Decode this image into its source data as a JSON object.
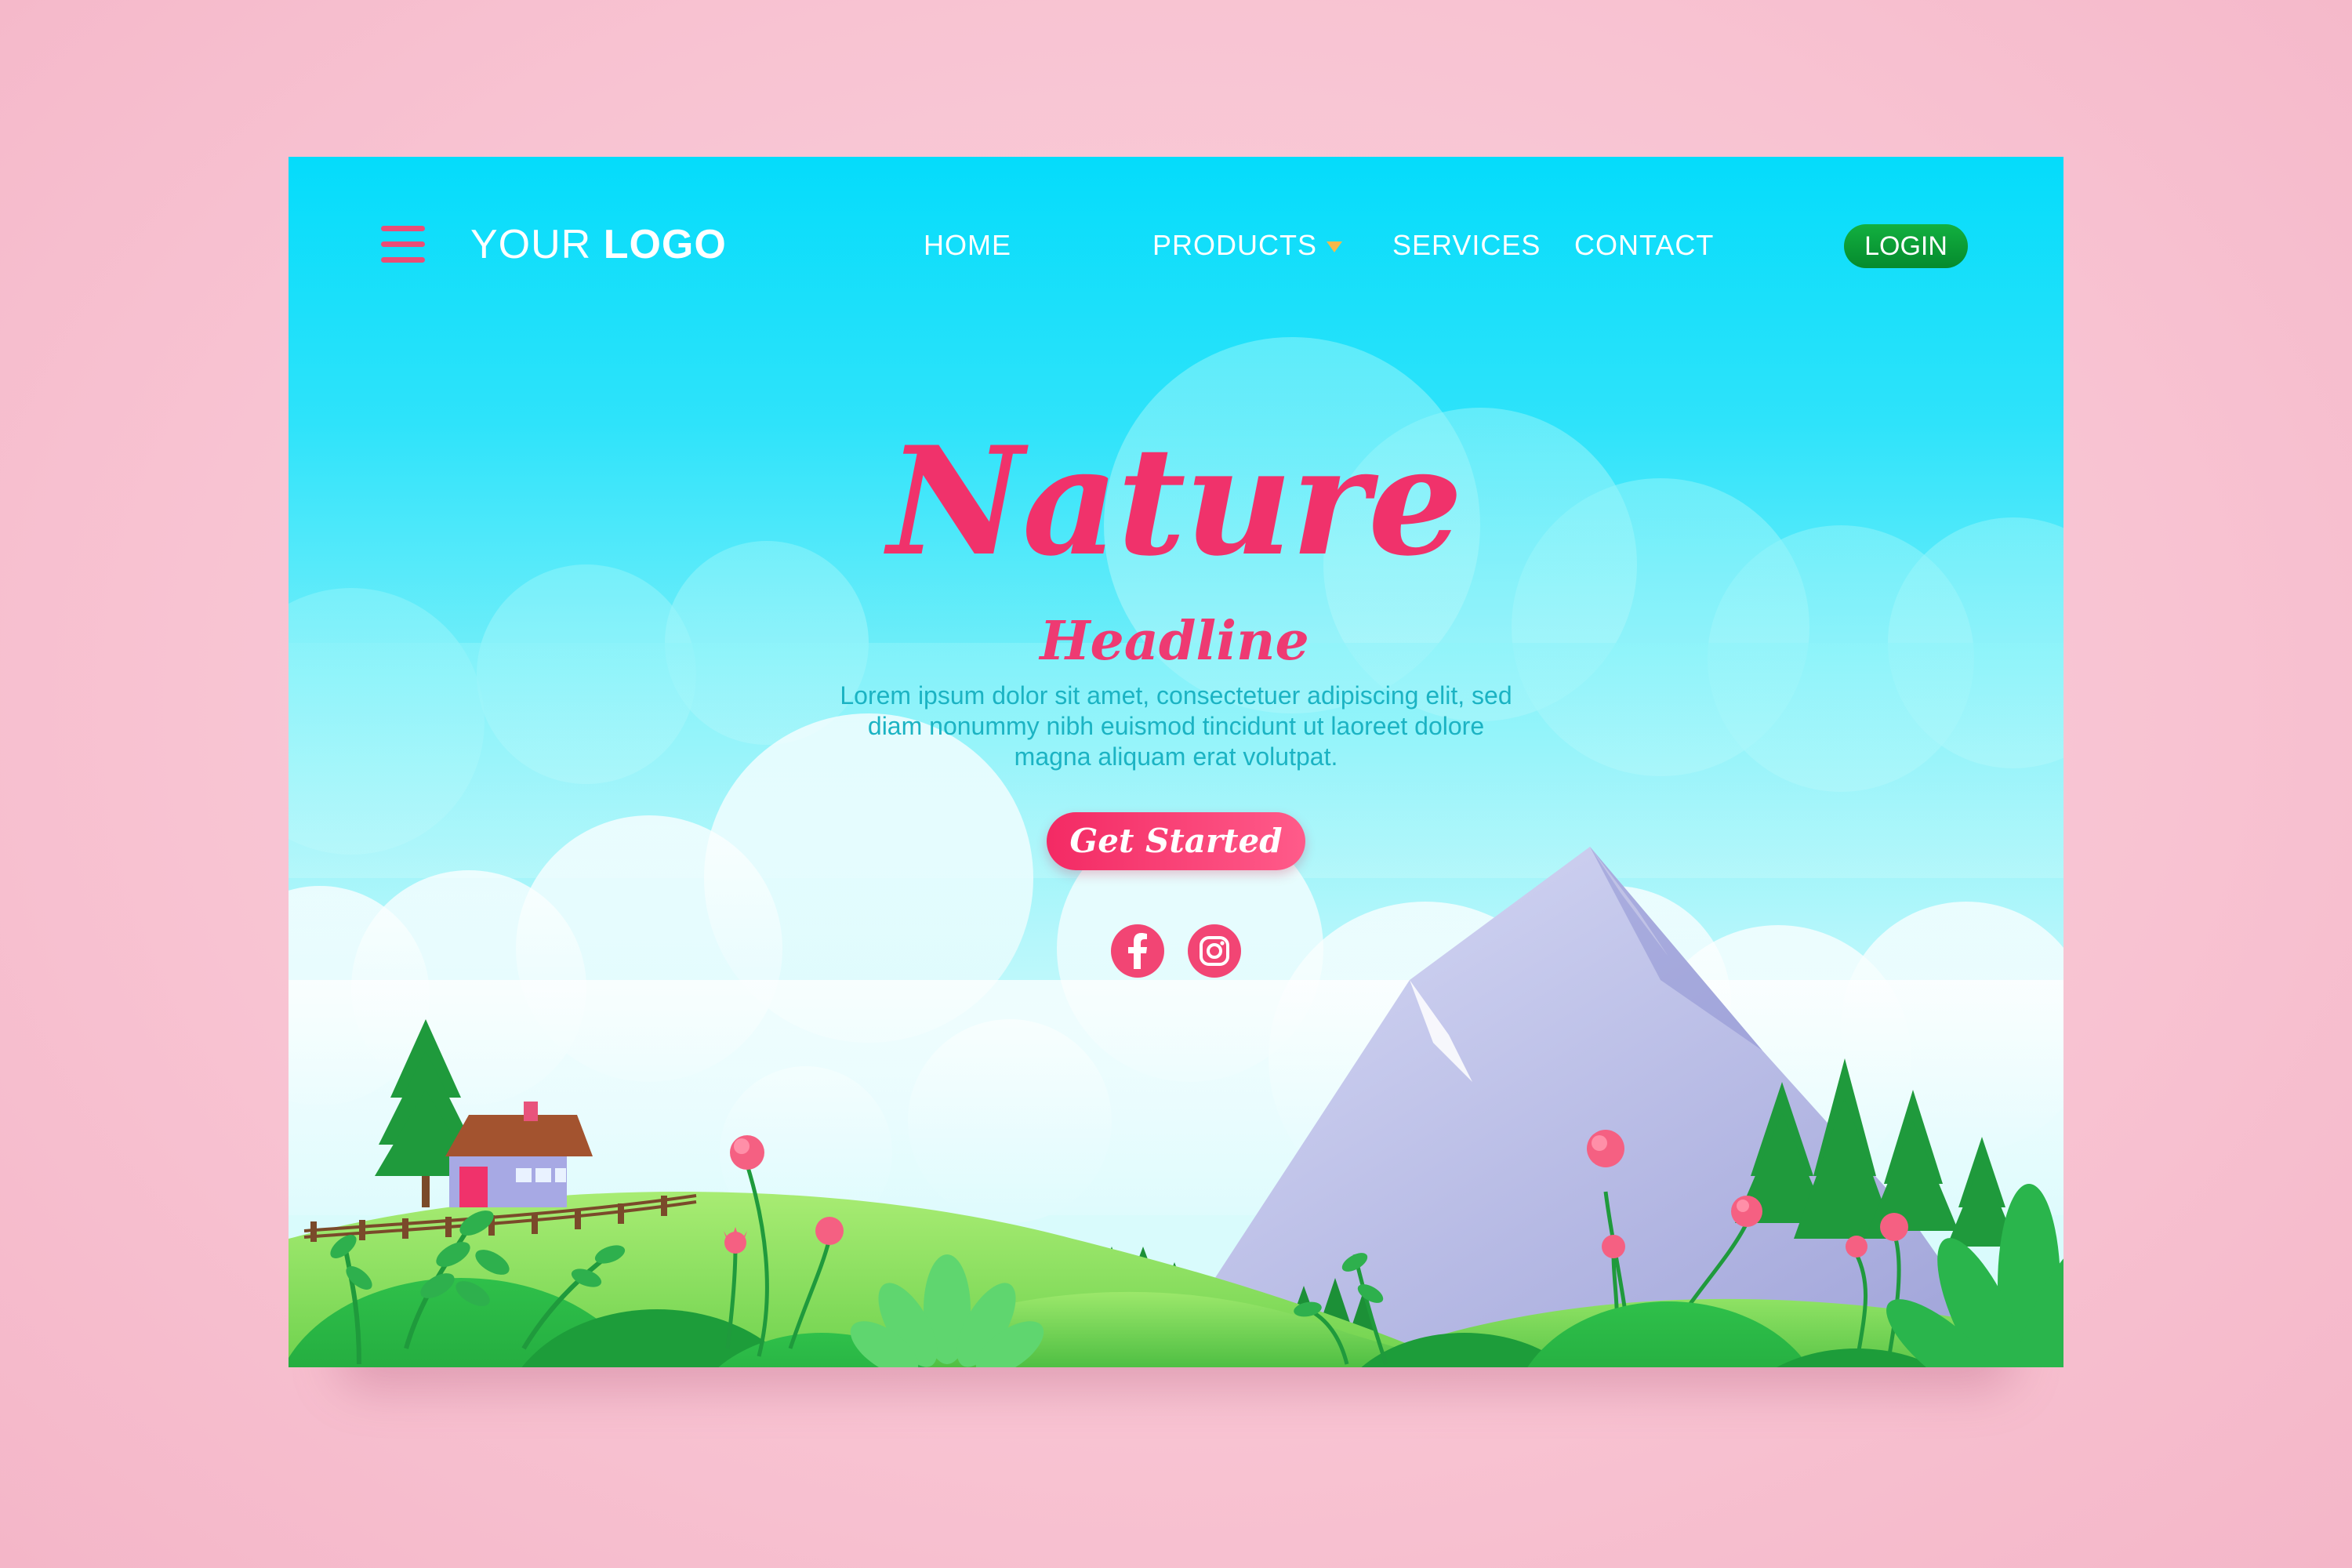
{
  "brand": {
    "logo_light": "YOUR ",
    "logo_bold": "LOGO"
  },
  "nav": {
    "home": "HOME",
    "products": "PRODUCTS",
    "services": "SERVICES",
    "contact": "CONTACT",
    "login": "LOGIN"
  },
  "hero": {
    "title": "Nature",
    "subtitle": "Headline",
    "body": "Lorem ipsum dolor sit amet, consectetuer adipiscing elit, sed diam nonummy nibh euismod tincidunt ut laoreet dolore magna aliquam erat volutpat.",
    "cta": "Get Started"
  },
  "social": [
    {
      "icon": "facebook-icon"
    },
    {
      "icon": "instagram-icon"
    }
  ],
  "colors": {
    "accent_pink": "#f0326b",
    "login_green": "#0a9a34",
    "body_teal": "#1bb3c3",
    "sky_top": "#04dcfb",
    "hill_green": "#7ed957"
  }
}
